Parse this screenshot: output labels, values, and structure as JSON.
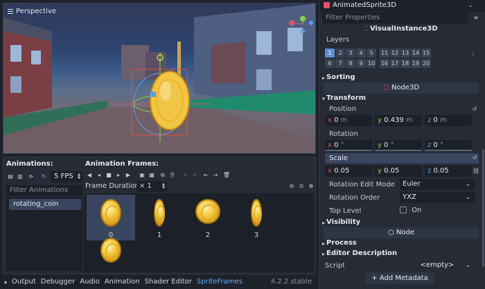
{
  "viewport": {
    "title": "Perspective"
  },
  "animations_panel": {
    "title": "Animations:",
    "fps": "5 FPS",
    "filter_placeholder": "Filter Animations",
    "items": [
      "rotating_coin"
    ]
  },
  "frames_panel": {
    "title": "Animation Frames:",
    "frame_duration_label": "Frame Duration:",
    "frame_duration_value": "× 1",
    "frames": [
      "0",
      "1",
      "2",
      "3",
      "4"
    ]
  },
  "bottom_bar": {
    "tabs": [
      "Output",
      "Debugger",
      "Audio",
      "Animation",
      "Shader Editor",
      "SpriteFrames"
    ],
    "active_tab": "SpriteFrames",
    "version": "4.2.2.stable"
  },
  "inspector": {
    "node_name": "AnimatedSprite3D",
    "filter_placeholder": "Filter Properties",
    "visual_instance_header": "VisualInstance3D",
    "layers_label": "Layers",
    "layers_row1": [
      "1",
      "2",
      "3",
      "4",
      "5",
      "11",
      "12",
      "13",
      "14",
      "15"
    ],
    "layers_row2": [
      "6",
      "7",
      "8",
      "9",
      "10",
      "16",
      "17",
      "18",
      "19",
      "20"
    ],
    "sorting_label": "Sorting",
    "node3d_header": "Node3D",
    "transform_label": "Transform",
    "position_label": "Position",
    "position": {
      "x": "0",
      "x_unit": "m",
      "y": "0.439",
      "y_unit": "m",
      "z": "0",
      "z_unit": "m"
    },
    "rotation_label": "Rotation",
    "rotation": {
      "x": "0",
      "y": "0",
      "z": "0",
      "unit": "°"
    },
    "scale_label": "Scale",
    "scale": {
      "x": "0.05",
      "y": "0.05",
      "z": "0.05"
    },
    "rotation_edit_mode_label": "Rotation Edit Mode",
    "rotation_edit_mode_value": "Euler",
    "rotation_order_label": "Rotation Order",
    "rotation_order_value": "YXZ",
    "top_level_label": "Top Level",
    "top_level_value": "On",
    "visibility_label": "Visibility",
    "node_header": "Node",
    "process_label": "Process",
    "editor_description_label": "Editor Description",
    "script_label": "Script",
    "script_value": "<empty>",
    "add_metadata_label": "Add Metadata"
  },
  "colors": {
    "accent": "#5fb2ff",
    "selection": "#3a4560",
    "axis_x": "#e0526a",
    "axis_y": "#8bd14a",
    "axis_z": "#5c9cf0"
  }
}
